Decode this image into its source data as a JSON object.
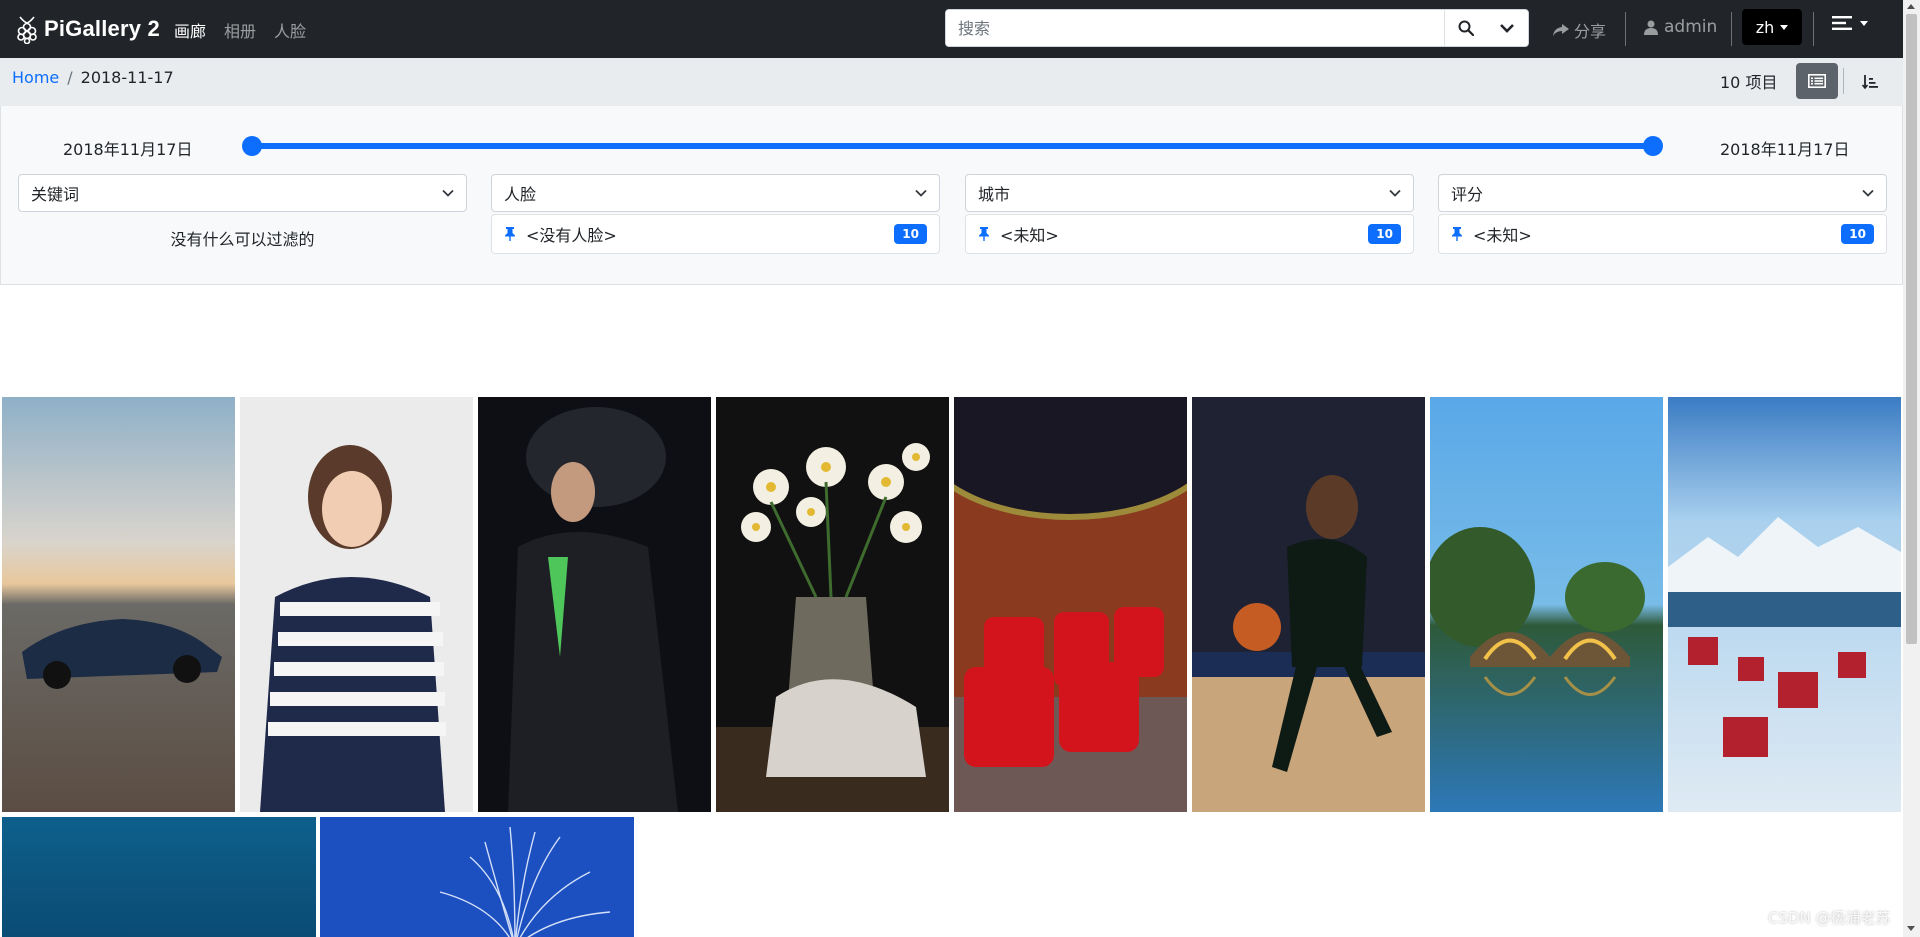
{
  "app": {
    "name": "PiGallery 2"
  },
  "nav": {
    "items": [
      {
        "label": "画廊"
      },
      {
        "label": "相册"
      },
      {
        "label": "人脸"
      }
    ]
  },
  "search": {
    "placeholder": "搜索",
    "value": ""
  },
  "header": {
    "share_label": "分享",
    "user_label": "admin",
    "lang_label": "zh"
  },
  "breadcrumb": {
    "home": "Home",
    "current": "2018-11-17"
  },
  "toolbar": {
    "items_count": "10 项目"
  },
  "filter": {
    "date_from": "2018年11月17日",
    "date_to": "2018年11月17日",
    "range_fraction": [
      0.0,
      1.0
    ],
    "columns": [
      {
        "select_label": "关键词",
        "empty_text": "没有什么可以过滤的"
      },
      {
        "select_label": "人脸",
        "pin_label": "<没有人脸>",
        "count": "10"
      },
      {
        "select_label": "城市",
        "pin_label": "<未知>",
        "count": "10"
      },
      {
        "select_label": "评分",
        "pin_label": "<未知>",
        "count": "10"
      }
    ]
  },
  "gallery": {
    "photos": [
      {
        "name": "car"
      },
      {
        "name": "woman-striped-sweater"
      },
      {
        "name": "man-in-rain-jacket"
      },
      {
        "name": "daffodils-in-vase"
      },
      {
        "name": "home-theater"
      },
      {
        "name": "basketball-player"
      },
      {
        "name": "lit-bridge-reflection"
      },
      {
        "name": "snowy-village"
      },
      {
        "name": "blue-ocean"
      },
      {
        "name": "fireworks"
      }
    ]
  },
  "watermark": "CSDN @杨浦老苏",
  "colors": {
    "navbar": "#212529",
    "accent": "#0d6efd",
    "crumbbar": "#e9ecef"
  }
}
